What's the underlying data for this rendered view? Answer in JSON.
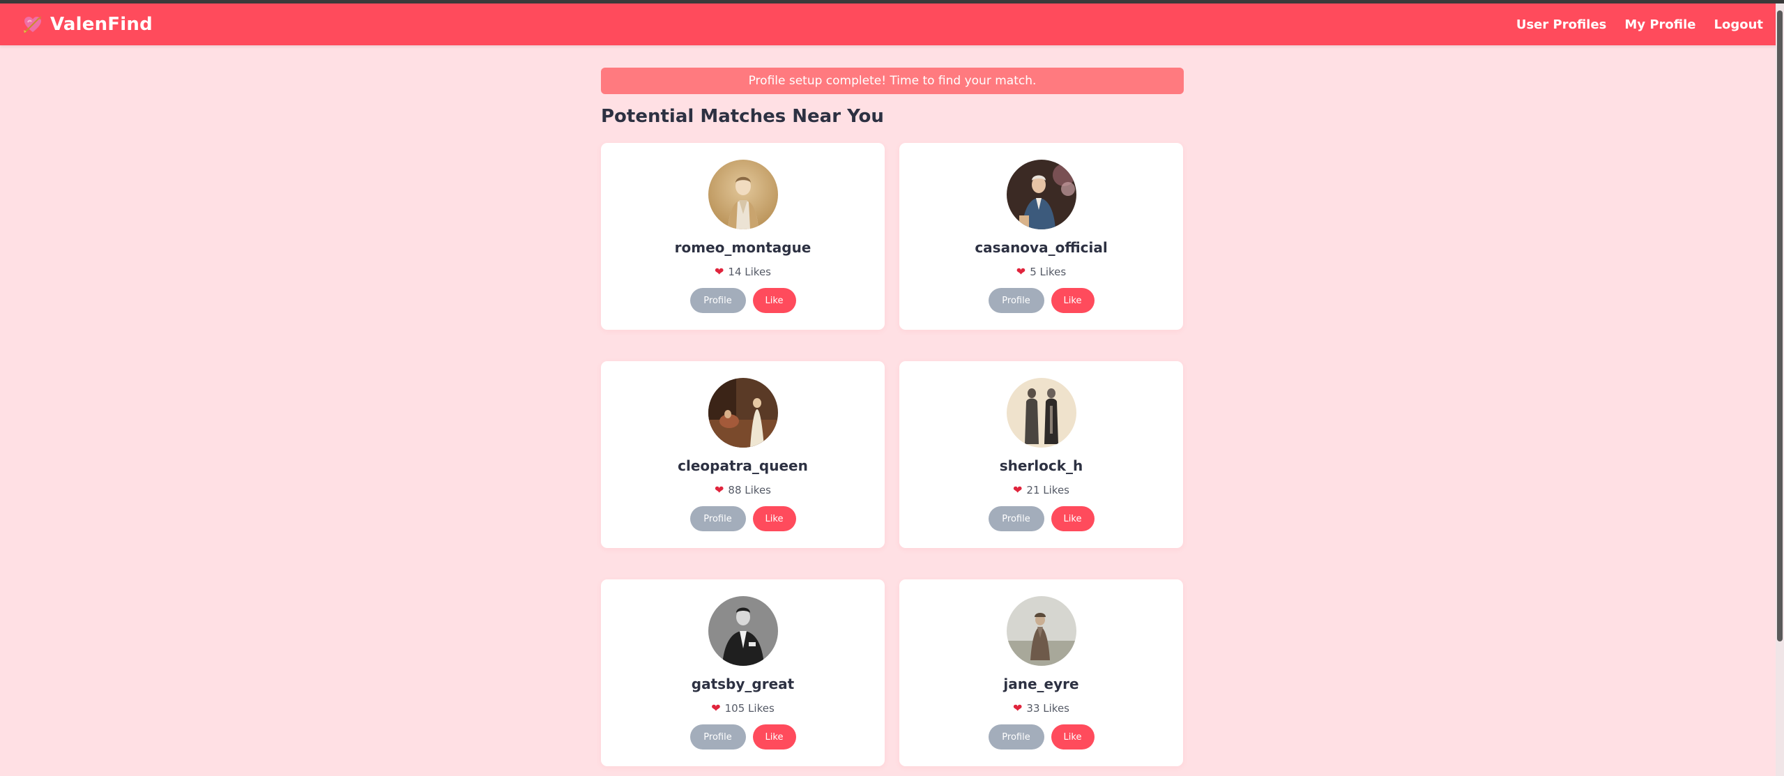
{
  "brand": {
    "name": "ValenFind",
    "icon": "cupid-arrow-heart-icon"
  },
  "nav": [
    {
      "label": "User Profiles"
    },
    {
      "label": "My Profile"
    },
    {
      "label": "Logout"
    }
  ],
  "flash": {
    "message": "Profile setup complete! Time to find your match."
  },
  "page": {
    "title": "Potential Matches Near You"
  },
  "profiles": [
    {
      "username": "romeo_montague",
      "likes": "14 Likes",
      "profile_label": "Profile",
      "like_label": "Like"
    },
    {
      "username": "casanova_official",
      "likes": "5 Likes",
      "profile_label": "Profile",
      "like_label": "Like"
    },
    {
      "username": "cleopatra_queen",
      "likes": "88 Likes",
      "profile_label": "Profile",
      "like_label": "Like"
    },
    {
      "username": "sherlock_h",
      "likes": "21 Likes",
      "profile_label": "Profile",
      "like_label": "Like"
    },
    {
      "username": "gatsby_great",
      "likes": "105 Likes",
      "profile_label": "Profile",
      "like_label": "Like"
    },
    {
      "username": "jane_eyre",
      "likes": "33 Likes",
      "profile_label": "Profile",
      "like_label": "Like"
    }
  ],
  "colors": {
    "brand": "#ff4b5c",
    "background": "#ffe0e4",
    "flash": "#ff7a7f",
    "profile_button": "#a3adbb",
    "like_button": "#ff4b5c"
  }
}
